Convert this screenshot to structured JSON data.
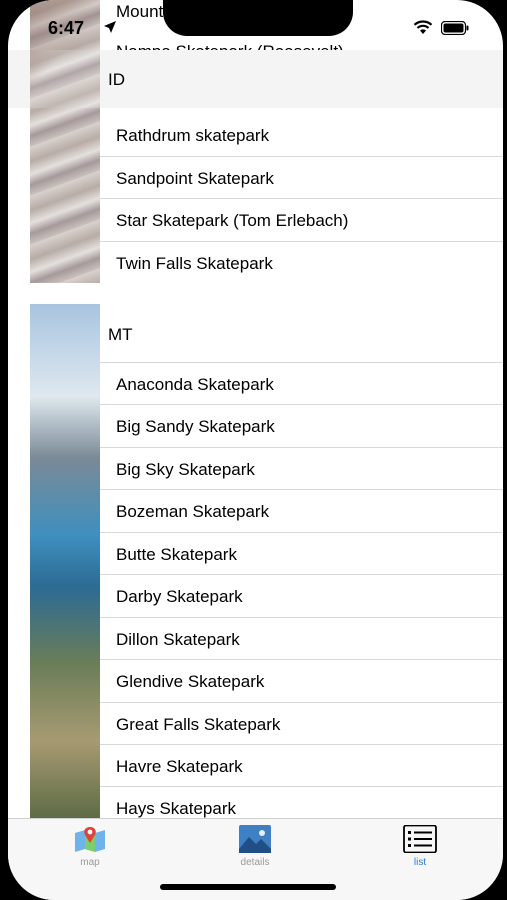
{
  "status": {
    "time": "6:47"
  },
  "list": {
    "top_clipped": [
      "Mount",
      "Nampa Skatepark (Roosevelt)"
    ],
    "sections": [
      {
        "title": "ID",
        "items": [
          "Rathdrum skatepark",
          "Sandpoint Skatepark",
          "Star Skatepark (Tom Erlebach)",
          "Twin Falls Skatepark"
        ]
      },
      {
        "title": "MT",
        "items": [
          "Anaconda Skatepark",
          "Big Sandy Skatepark",
          "Big Sky Skatepark",
          "Bozeman Skatepark",
          "Butte Skatepark",
          "Darby Skatepark",
          "Dillon Skatepark",
          "Glendive Skatepark",
          "Great Falls Skatepark",
          "Havre Skatepark",
          "Hays Skatepark"
        ]
      }
    ]
  },
  "tabbar": {
    "tabs": [
      {
        "label": "map",
        "icon": "map-icon"
      },
      {
        "label": "details",
        "icon": "image-icon"
      },
      {
        "label": "list",
        "icon": "list-icon"
      }
    ],
    "active_color": "#2f7ad9",
    "inactive_color": "#9a9a9a"
  }
}
